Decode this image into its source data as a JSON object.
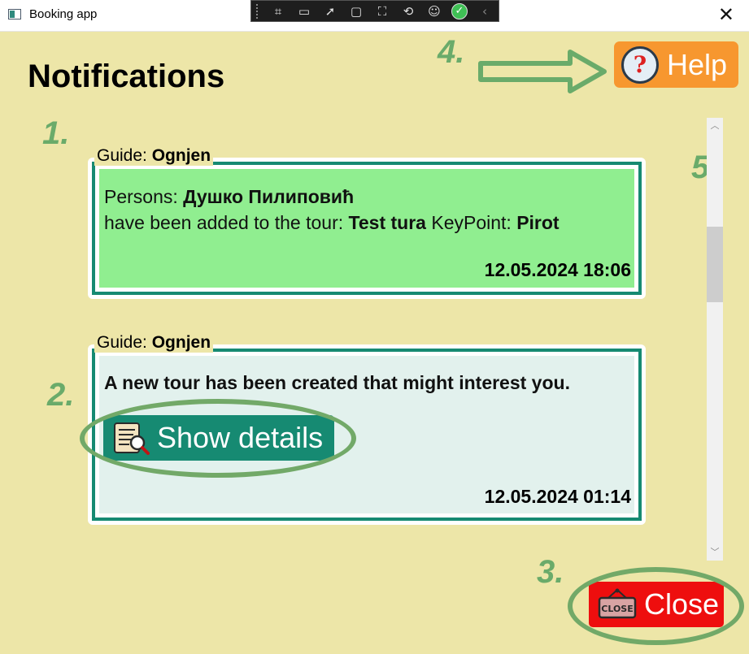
{
  "window": {
    "title": "Booking app",
    "close_symbol": "✕"
  },
  "devtools": {
    "tools": [
      "select-element-icon",
      "record-icon",
      "pointer-icon",
      "frame-icon",
      "track-focus-icon",
      "binding-icon",
      "accessibility-icon",
      "check-ok-icon",
      "chevron-left-icon"
    ]
  },
  "page": {
    "heading": "Notifications"
  },
  "markers": [
    "1.",
    "2.",
    "3.",
    "4.",
    "5."
  ],
  "help": {
    "label": "Help",
    "icon_glyph": "?"
  },
  "notifications": [
    {
      "guide_label": "Guide: ",
      "guide_name": "Ognjen",
      "persons_label": "Persons: ",
      "persons_name": "Душко Пилиповић",
      "added_text": "have been added to the tour: ",
      "tour_name": "Test tura",
      "keypoint_label": " KeyPoint: ",
      "keypoint_name": "Pirot",
      "date": "12.05.2024 18:06",
      "background": "#90ee90"
    },
    {
      "guide_label": "Guide: ",
      "guide_name": "Ognjen",
      "message": "A new tour has been created that might interest you.",
      "button_label": "Show details",
      "date": "12.05.2024 01:14",
      "background": "#e2f1ed"
    }
  ],
  "close": {
    "label": "Close",
    "sign_text": "CLOSE"
  },
  "colors": {
    "background": "#ede6a8",
    "accent": "#168a72",
    "help": "#f7972f",
    "close": "#ee0e0e",
    "annotation": "#6aab6a"
  }
}
